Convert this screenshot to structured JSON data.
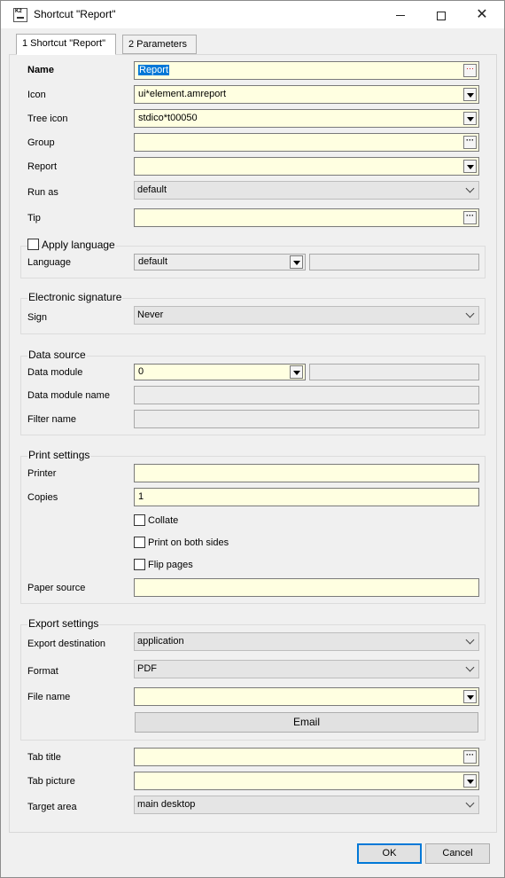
{
  "window": {
    "title": "Shortcut \"Report\"",
    "app_icon_text": "K2"
  },
  "tabs": [
    {
      "label": "1 Shortcut \"Report\"",
      "active": true
    },
    {
      "label": "2 Parameters",
      "active": false
    }
  ],
  "fields": {
    "name": {
      "label": "Name",
      "value": "Report"
    },
    "icon": {
      "label": "Icon",
      "value": "ui*element.amreport"
    },
    "tree_icon": {
      "label": "Tree icon",
      "value": "stdico*t00050"
    },
    "group": {
      "label": "Group",
      "value": ""
    },
    "report": {
      "label": "Report",
      "value": ""
    },
    "run_as": {
      "label": "Run as",
      "value": "default"
    },
    "tip": {
      "label": "Tip",
      "value": ""
    }
  },
  "apply_language": {
    "label": "Apply language",
    "checked": false,
    "language_label": "Language",
    "language_value": "default",
    "language_extra": ""
  },
  "electronic_signature": {
    "title": "Electronic signature",
    "sign_label": "Sign",
    "sign_value": "Never"
  },
  "data_source": {
    "title": "Data source",
    "data_module_label": "Data module",
    "data_module_value": "0",
    "data_module_extra": "",
    "data_module_name_label": "Data module name",
    "data_module_name_value": "",
    "filter_name_label": "Filter name",
    "filter_name_value": ""
  },
  "print_settings": {
    "title": "Print settings",
    "printer_label": "Printer",
    "printer_value": "",
    "copies_label": "Copies",
    "copies_value": "1",
    "collate_label": "Collate",
    "both_sides_label": "Print on both sides",
    "flip_pages_label": "Flip pages",
    "paper_source_label": "Paper source",
    "paper_source_value": ""
  },
  "export_settings": {
    "title": "Export settings",
    "destination_label": "Export destination",
    "destination_value": "application",
    "format_label": "Format",
    "format_value": "PDF",
    "file_name_label": "File name",
    "file_name_value": "",
    "email_label": "Email"
  },
  "bottom_fields": {
    "tab_title_label": "Tab title",
    "tab_title_value": "",
    "tab_picture_label": "Tab picture",
    "tab_picture_value": "",
    "target_area_label": "Target area",
    "target_area_value": "main desktop"
  },
  "buttons": {
    "ok": "OK",
    "cancel": "Cancel"
  },
  "colors": {
    "input_bg": "#ffffe1",
    "accent": "#0078d7",
    "selection": "#0078d7"
  }
}
